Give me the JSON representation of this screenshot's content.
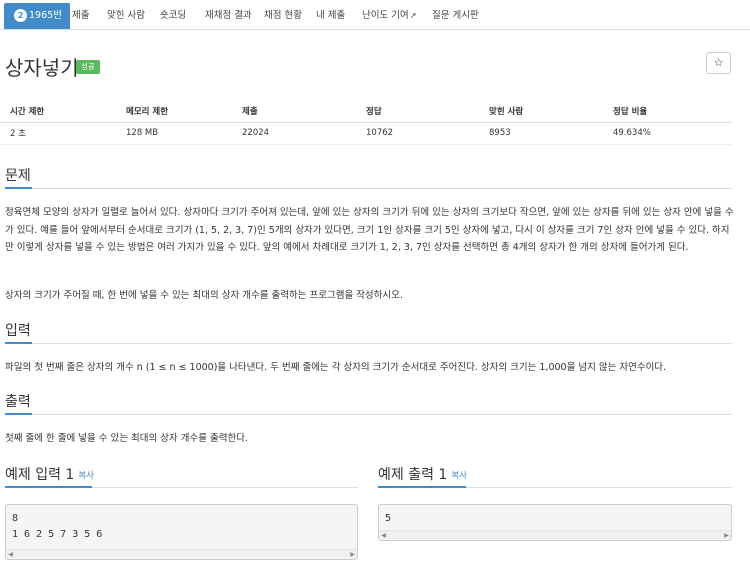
{
  "tabs": [
    {
      "label": "1965번",
      "badge": "2"
    },
    {
      "label": "제출"
    },
    {
      "label": "맞힌 사람"
    },
    {
      "label": "숏코딩"
    },
    {
      "label": "재채점 결과"
    },
    {
      "label": "채점 현황"
    },
    {
      "label": "내 제출"
    },
    {
      "label": "난이도 기여"
    },
    {
      "label": "질문 게시판"
    }
  ],
  "title": "상자넣기",
  "status_badge": "성공",
  "star": "☆",
  "info": {
    "headers": [
      "시간 제한",
      "메모리 제한",
      "제출",
      "정답",
      "맞힌 사람",
      "정답 비율"
    ],
    "values": [
      "2 초",
      "128 MB",
      "22024",
      "10762",
      "8953",
      "49.634%"
    ]
  },
  "problem": {
    "heading": "문제",
    "p1": "정육면체 모양의 상자가 일렬로 늘어서 있다. 상자마다 크기가 주어져 있는데, 앞에 있는 상자의 크기가 뒤에 있는 상자의 크기보다 작으면, 앞에 있는 상자를 뒤에 있는 상자 안에 넣을 수가 있다. 예를 들어 앞에서부터 순서대로 크기가 (1, 5, 2, 3, 7)인 5개의 상자가 있다면, 크기 1인 상자를 크기 5인 상자에 넣고, 다시 이 상자를 크기 7인 상자 안에 넣을 수 있다. 하지만 이렇게 상자를 넣을 수 있는 방법은 여러 가지가 있을 수 있다. 앞의 예에서 차례대로 크기가 1, 2, 3, 7인 상자를 선택하면 총 4개의 상자가 한 개의 상자에 들어가게 된다.",
    "p2": "상자의 크기가 주어질 때, 한 번에 넣을 수 있는 최대의 상자 개수를 출력하는 프로그램을 작성하시오."
  },
  "input": {
    "heading": "입력",
    "text": "파일의 첫 번째 줄은 상자의 개수 n (1 ≤ n ≤ 1000)을 나타낸다. 두 번째 줄에는 각 상자의 크기가 순서대로 주어진다. 상자의 크기는 1,000을 넘지 않는 자연수이다."
  },
  "output": {
    "heading": "출력",
    "text": "첫째 줄에 한 줄에 넣을 수 있는 최대의 상자 개수를 출력한다."
  },
  "sample_input": {
    "heading": "예제 입력 1",
    "copy": "복사",
    "content": "8\n1 6 2 5 7 3 5 6"
  },
  "sample_output": {
    "heading": "예제 출력 1",
    "copy": "복사",
    "content": "5"
  }
}
